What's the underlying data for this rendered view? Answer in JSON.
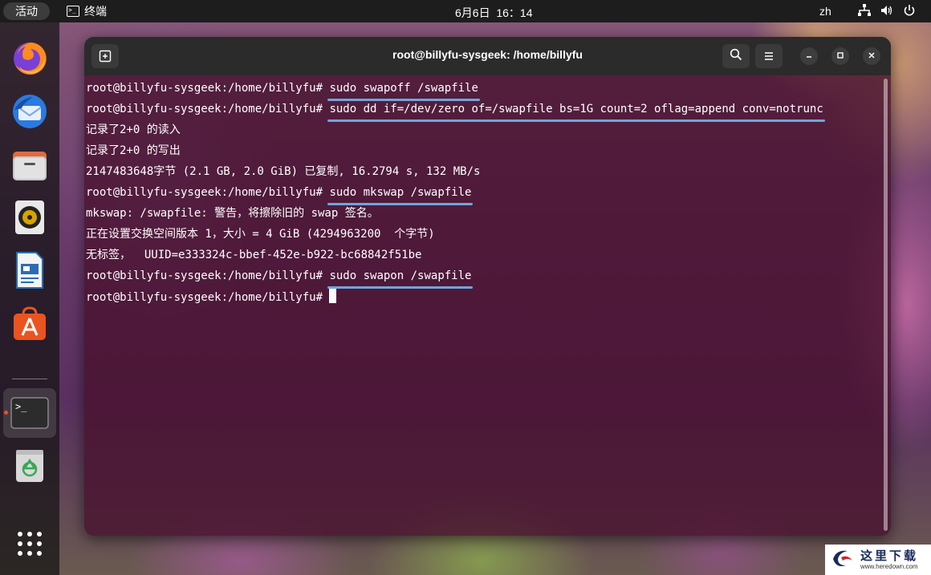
{
  "topbar": {
    "activities": "活动",
    "app_name": "终端",
    "clock": "6月6日  16：14",
    "input_method": "zh"
  },
  "dock": {
    "items": [
      "firefox-icon",
      "thunderbird-icon",
      "files-icon",
      "rhythmbox-icon",
      "writer-icon",
      "app-center-icon",
      "terminal-icon",
      "trash-icon",
      "show-apps-icon"
    ],
    "accent_color": "#e95420"
  },
  "window": {
    "title": "root@billyfu-sysgeek: /home/billyfu"
  },
  "terminal": {
    "prompt": "root@billyfu-sysgeek:/home/billyfu#",
    "lines": [
      {
        "type": "cmd",
        "text": "sudo swapoff /swapfile"
      },
      {
        "type": "cmd",
        "text": "sudo dd if=/dev/zero of=/swapfile bs=1G count=2 oflag=append conv=notrunc"
      },
      {
        "type": "out",
        "text": "记录了2+0 的读入"
      },
      {
        "type": "out",
        "text": "记录了2+0 的写出"
      },
      {
        "type": "out",
        "text": "2147483648字节 (2.1 GB, 2.0 GiB) 已复制, 16.2794 s, 132 MB/s"
      },
      {
        "type": "cmd",
        "text": "sudo mkswap /swapfile"
      },
      {
        "type": "out",
        "text": "mkswap: /swapfile: 警告，将擦除旧的 swap 签名。"
      },
      {
        "type": "out",
        "text": "正在设置交换空间版本 1，大小 = 4 GiB (4294963200  个字节)"
      },
      {
        "type": "out",
        "text": "无标签，  UUID=e333324c-bbef-452e-b922-bc68842f51be"
      },
      {
        "type": "cmd",
        "text": "sudo swapon /swapfile"
      },
      {
        "type": "prompt",
        "text": ""
      }
    ],
    "highlight_color": "#6ea6dc"
  },
  "watermark": {
    "title": "这里下载",
    "url": "www.heredown.com"
  }
}
